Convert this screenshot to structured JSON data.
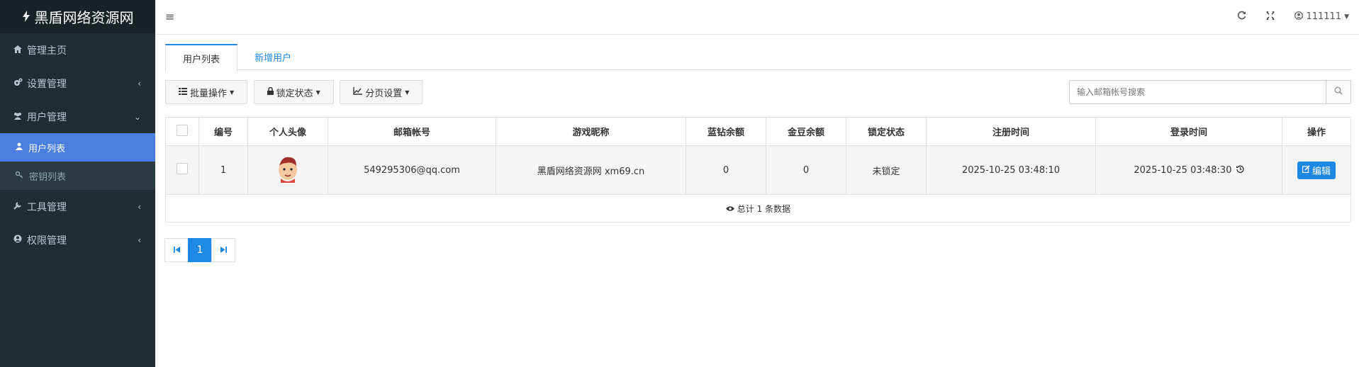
{
  "brand": {
    "icon": "bolt-icon",
    "title": "黑盾网络资源网"
  },
  "sidebar": {
    "items": [
      {
        "label": "管理主页",
        "icon": "home-icon",
        "caret": ""
      },
      {
        "label": "设置管理",
        "icon": "cogs-icon",
        "caret": "‹"
      },
      {
        "label": "用户管理",
        "icon": "users-icon",
        "caret": "⌄"
      }
    ],
    "sub": [
      {
        "label": "用户列表",
        "icon": "user-icon"
      },
      {
        "label": "密钥列表",
        "icon": "key-icon"
      }
    ],
    "items2": [
      {
        "label": "工具管理",
        "icon": "wrench-icon",
        "caret": "‹"
      },
      {
        "label": "权限管理",
        "icon": "user-circle-icon",
        "caret": "‹"
      }
    ]
  },
  "topbar": {
    "user": "111111"
  },
  "tabs": [
    "用户列表",
    "新增用户"
  ],
  "toolbar": {
    "batch": "批量操作",
    "lock": "锁定状态",
    "paging": "分页设置",
    "search_placeholder": "输入邮箱帐号搜索"
  },
  "table": {
    "headers": [
      "编号",
      "个人头像",
      "邮箱帐号",
      "游戏昵称",
      "蓝钻余额",
      "金豆余额",
      "锁定状态",
      "注册时间",
      "登录时间",
      "操作"
    ],
    "row": {
      "id": "1",
      "email": "549295306@qq.com",
      "nickname": "黑盾网络资源网 xm69.cn",
      "blue": "0",
      "gold": "0",
      "lock": "未锁定",
      "reg": "2025-10-25 03:48:10",
      "login": "2025-10-25 03:48:30",
      "action": "编辑"
    },
    "footer": "总计 1 条数据"
  },
  "pager": {
    "current": "1"
  },
  "colors": {
    "sidebar": "#222d32",
    "accent": "#1e88e5",
    "active_nav": "#4a7fe0"
  }
}
